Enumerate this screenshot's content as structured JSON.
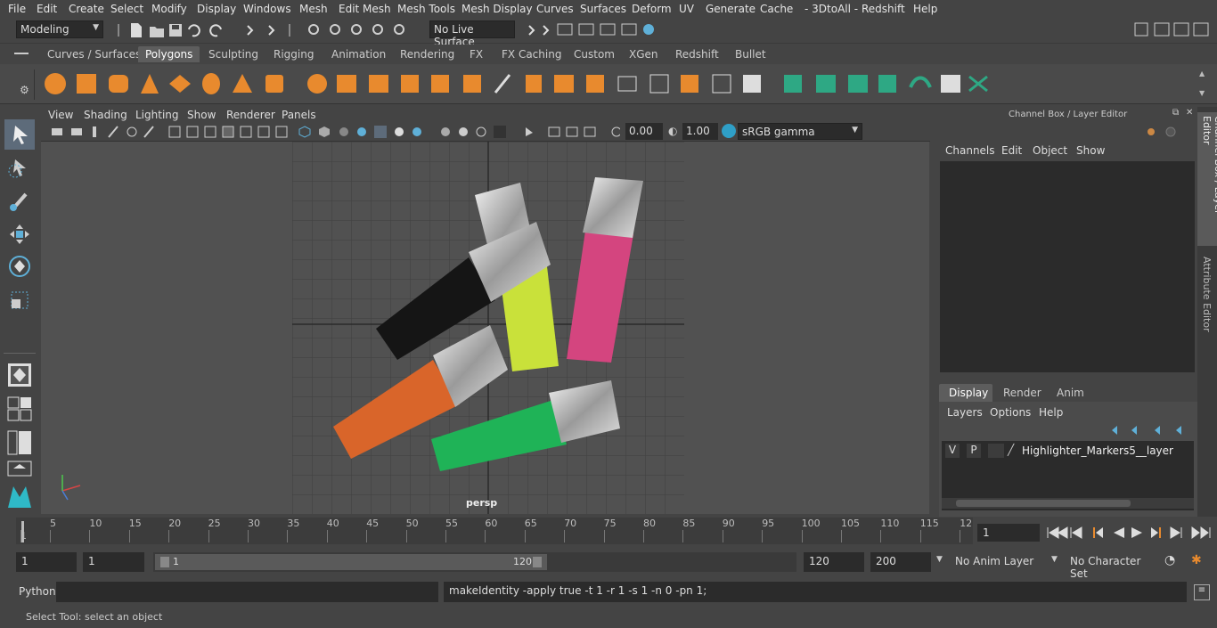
{
  "menu": [
    "File",
    "Edit",
    "Create",
    "Select",
    "Modify",
    "Display",
    "Windows",
    "Mesh",
    "Edit Mesh",
    "Mesh Tools",
    "Mesh Display",
    "Curves",
    "Surfaces",
    "Deform",
    "UV",
    "Generate",
    "Cache",
    "- 3DtoAll -",
    "Redshift",
    "Help"
  ],
  "status": {
    "mode": "Modeling",
    "live_surface": "No Live Surface"
  },
  "shelf_tabs": [
    "Curves / Surfaces",
    "Polygons",
    "Sculpting",
    "Rigging",
    "Animation",
    "Rendering",
    "FX",
    "FX Caching",
    "Custom",
    "XGen",
    "Redshift",
    "Bullet"
  ],
  "shelf_active": "Polygons",
  "viewport": {
    "menu": [
      "View",
      "Shading",
      "Lighting",
      "Show",
      "Renderer",
      "Panels"
    ],
    "exposure": "0.00",
    "gamma": "1.00",
    "colorspace": "sRGB gamma",
    "camera": "persp"
  },
  "channel_box": {
    "title": "Channel Box / Layer Editor",
    "menu": [
      "Channels",
      "Edit",
      "Object",
      "Show"
    ],
    "layer_tabs": [
      "Display",
      "Render",
      "Anim"
    ],
    "layer_menu": [
      "Layers",
      "Options",
      "Help"
    ],
    "layer": {
      "v": "V",
      "p": "P",
      "name": "Highlighter_Markers5__layer"
    }
  },
  "side_tabs": [
    "Channel Box / Layer Editor",
    "Attribute Editor"
  ],
  "timeline": {
    "ticks": [
      "1",
      "5",
      "10",
      "15",
      "20",
      "25",
      "30",
      "35",
      "40",
      "45",
      "50",
      "55",
      "60",
      "65",
      "70",
      "75",
      "80",
      "85",
      "90",
      "95",
      "100",
      "105",
      "110",
      "115",
      "12"
    ],
    "current_frame": "1"
  },
  "range": {
    "start": "1",
    "start2": "1",
    "slider_start": "1",
    "slider_end": "120",
    "end": "120",
    "end2": "200",
    "anim_layer": "No Anim Layer",
    "char_set": "No Character Set"
  },
  "command": {
    "lang": "Python",
    "result": "makeIdentity -apply true -t 1 -r 1 -s 1 -n 0 -pn 1;"
  },
  "help_line": "Select Tool: select an object",
  "colors": {
    "black_marker": "#151515",
    "yellow_marker": "#c9e13a",
    "pink_marker": "#d4457f",
    "orange_marker": "#d9652a",
    "green_marker": "#1fb357"
  }
}
